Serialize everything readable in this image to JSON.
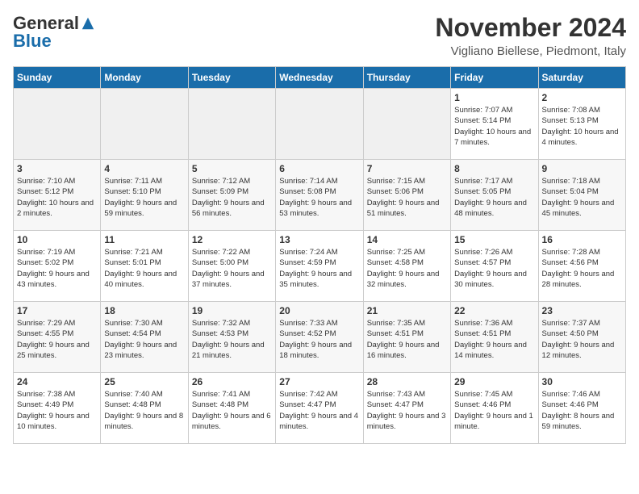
{
  "logo": {
    "general": "General",
    "blue": "Blue"
  },
  "title": "November 2024",
  "location": "Vigliano Biellese, Piedmont, Italy",
  "days_of_week": [
    "Sunday",
    "Monday",
    "Tuesday",
    "Wednesday",
    "Thursday",
    "Friday",
    "Saturday"
  ],
  "weeks": [
    [
      {
        "day": "",
        "empty": true
      },
      {
        "day": "",
        "empty": true
      },
      {
        "day": "",
        "empty": true
      },
      {
        "day": "",
        "empty": true
      },
      {
        "day": "",
        "empty": true
      },
      {
        "day": "1",
        "sunrise": "Sunrise: 7:07 AM",
        "sunset": "Sunset: 5:14 PM",
        "daylight": "Daylight: 10 hours and 7 minutes."
      },
      {
        "day": "2",
        "sunrise": "Sunrise: 7:08 AM",
        "sunset": "Sunset: 5:13 PM",
        "daylight": "Daylight: 10 hours and 4 minutes."
      }
    ],
    [
      {
        "day": "3",
        "sunrise": "Sunrise: 7:10 AM",
        "sunset": "Sunset: 5:12 PM",
        "daylight": "Daylight: 10 hours and 2 minutes."
      },
      {
        "day": "4",
        "sunrise": "Sunrise: 7:11 AM",
        "sunset": "Sunset: 5:10 PM",
        "daylight": "Daylight: 9 hours and 59 minutes."
      },
      {
        "day": "5",
        "sunrise": "Sunrise: 7:12 AM",
        "sunset": "Sunset: 5:09 PM",
        "daylight": "Daylight: 9 hours and 56 minutes."
      },
      {
        "day": "6",
        "sunrise": "Sunrise: 7:14 AM",
        "sunset": "Sunset: 5:08 PM",
        "daylight": "Daylight: 9 hours and 53 minutes."
      },
      {
        "day": "7",
        "sunrise": "Sunrise: 7:15 AM",
        "sunset": "Sunset: 5:06 PM",
        "daylight": "Daylight: 9 hours and 51 minutes."
      },
      {
        "day": "8",
        "sunrise": "Sunrise: 7:17 AM",
        "sunset": "Sunset: 5:05 PM",
        "daylight": "Daylight: 9 hours and 48 minutes."
      },
      {
        "day": "9",
        "sunrise": "Sunrise: 7:18 AM",
        "sunset": "Sunset: 5:04 PM",
        "daylight": "Daylight: 9 hours and 45 minutes."
      }
    ],
    [
      {
        "day": "10",
        "sunrise": "Sunrise: 7:19 AM",
        "sunset": "Sunset: 5:02 PM",
        "daylight": "Daylight: 9 hours and 43 minutes."
      },
      {
        "day": "11",
        "sunrise": "Sunrise: 7:21 AM",
        "sunset": "Sunset: 5:01 PM",
        "daylight": "Daylight: 9 hours and 40 minutes."
      },
      {
        "day": "12",
        "sunrise": "Sunrise: 7:22 AM",
        "sunset": "Sunset: 5:00 PM",
        "daylight": "Daylight: 9 hours and 37 minutes."
      },
      {
        "day": "13",
        "sunrise": "Sunrise: 7:24 AM",
        "sunset": "Sunset: 4:59 PM",
        "daylight": "Daylight: 9 hours and 35 minutes."
      },
      {
        "day": "14",
        "sunrise": "Sunrise: 7:25 AM",
        "sunset": "Sunset: 4:58 PM",
        "daylight": "Daylight: 9 hours and 32 minutes."
      },
      {
        "day": "15",
        "sunrise": "Sunrise: 7:26 AM",
        "sunset": "Sunset: 4:57 PM",
        "daylight": "Daylight: 9 hours and 30 minutes."
      },
      {
        "day": "16",
        "sunrise": "Sunrise: 7:28 AM",
        "sunset": "Sunset: 4:56 PM",
        "daylight": "Daylight: 9 hours and 28 minutes."
      }
    ],
    [
      {
        "day": "17",
        "sunrise": "Sunrise: 7:29 AM",
        "sunset": "Sunset: 4:55 PM",
        "daylight": "Daylight: 9 hours and 25 minutes."
      },
      {
        "day": "18",
        "sunrise": "Sunrise: 7:30 AM",
        "sunset": "Sunset: 4:54 PM",
        "daylight": "Daylight: 9 hours and 23 minutes."
      },
      {
        "day": "19",
        "sunrise": "Sunrise: 7:32 AM",
        "sunset": "Sunset: 4:53 PM",
        "daylight": "Daylight: 9 hours and 21 minutes."
      },
      {
        "day": "20",
        "sunrise": "Sunrise: 7:33 AM",
        "sunset": "Sunset: 4:52 PM",
        "daylight": "Daylight: 9 hours and 18 minutes."
      },
      {
        "day": "21",
        "sunrise": "Sunrise: 7:35 AM",
        "sunset": "Sunset: 4:51 PM",
        "daylight": "Daylight: 9 hours and 16 minutes."
      },
      {
        "day": "22",
        "sunrise": "Sunrise: 7:36 AM",
        "sunset": "Sunset: 4:51 PM",
        "daylight": "Daylight: 9 hours and 14 minutes."
      },
      {
        "day": "23",
        "sunrise": "Sunrise: 7:37 AM",
        "sunset": "Sunset: 4:50 PM",
        "daylight": "Daylight: 9 hours and 12 minutes."
      }
    ],
    [
      {
        "day": "24",
        "sunrise": "Sunrise: 7:38 AM",
        "sunset": "Sunset: 4:49 PM",
        "daylight": "Daylight: 9 hours and 10 minutes."
      },
      {
        "day": "25",
        "sunrise": "Sunrise: 7:40 AM",
        "sunset": "Sunset: 4:48 PM",
        "daylight": "Daylight: 9 hours and 8 minutes."
      },
      {
        "day": "26",
        "sunrise": "Sunrise: 7:41 AM",
        "sunset": "Sunset: 4:48 PM",
        "daylight": "Daylight: 9 hours and 6 minutes."
      },
      {
        "day": "27",
        "sunrise": "Sunrise: 7:42 AM",
        "sunset": "Sunset: 4:47 PM",
        "daylight": "Daylight: 9 hours and 4 minutes."
      },
      {
        "day": "28",
        "sunrise": "Sunrise: 7:43 AM",
        "sunset": "Sunset: 4:47 PM",
        "daylight": "Daylight: 9 hours and 3 minutes."
      },
      {
        "day": "29",
        "sunrise": "Sunrise: 7:45 AM",
        "sunset": "Sunset: 4:46 PM",
        "daylight": "Daylight: 9 hours and 1 minute."
      },
      {
        "day": "30",
        "sunrise": "Sunrise: 7:46 AM",
        "sunset": "Sunset: 4:46 PM",
        "daylight": "Daylight: 8 hours and 59 minutes."
      }
    ]
  ]
}
